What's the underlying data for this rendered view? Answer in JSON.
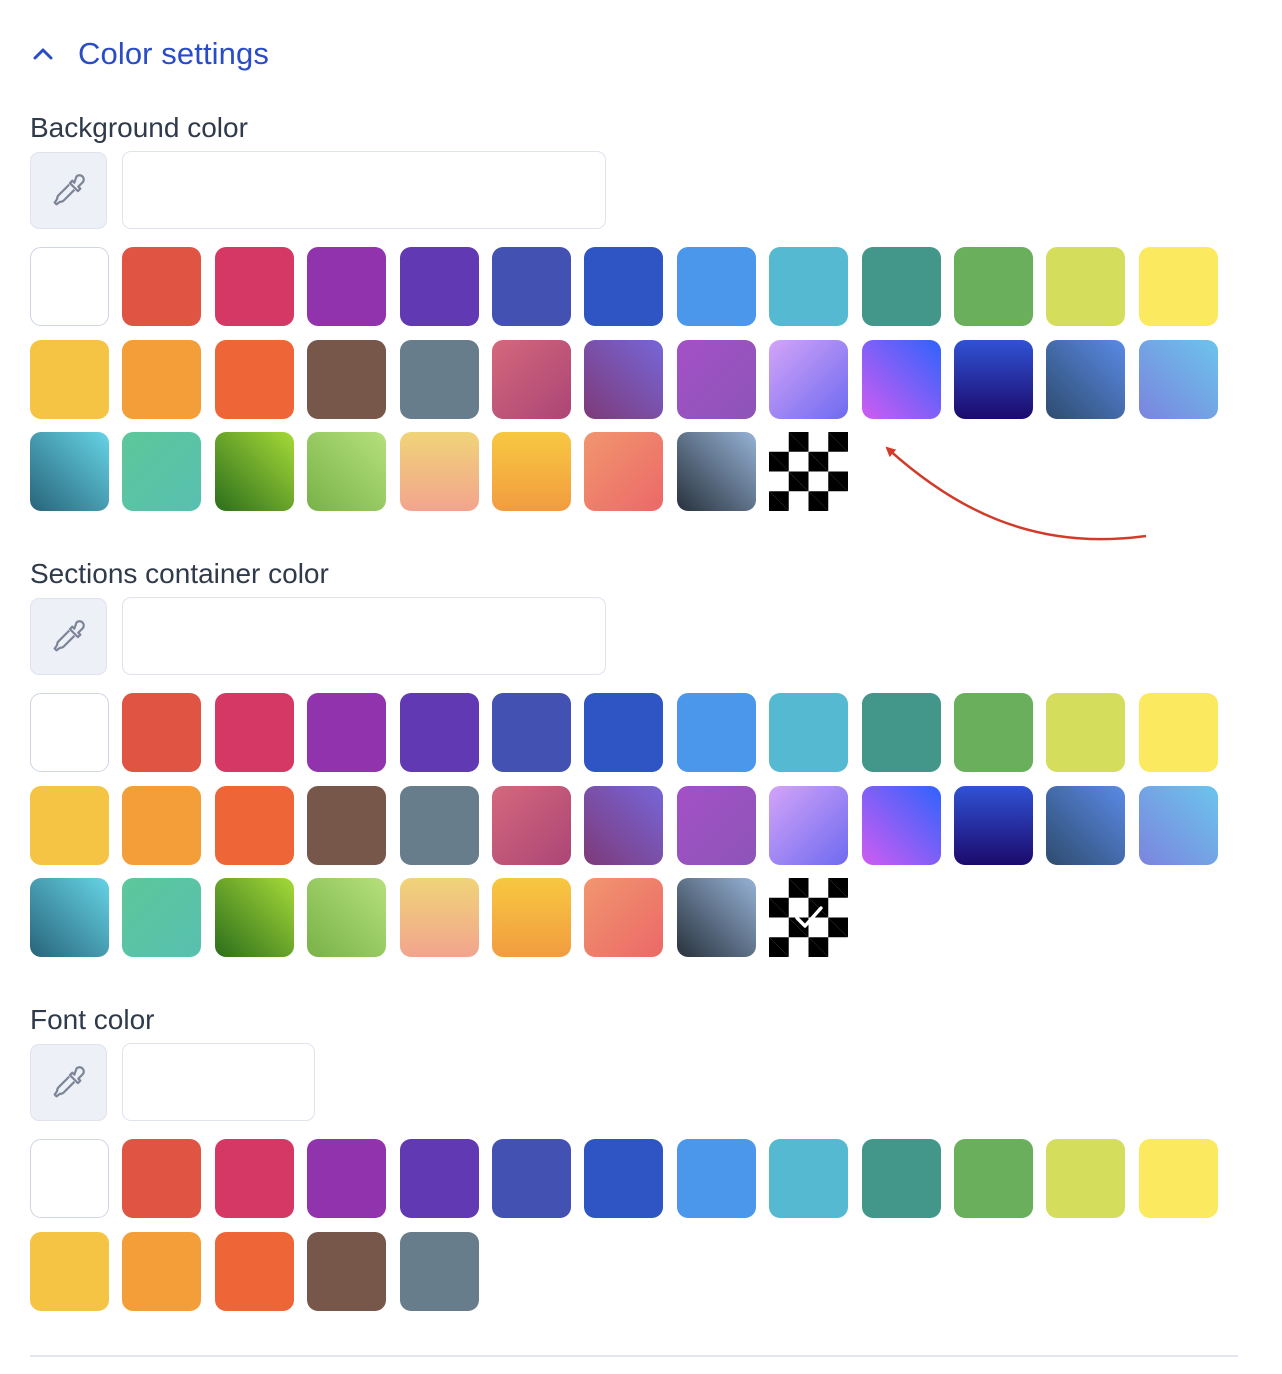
{
  "section": {
    "title": "Color settings",
    "chevron_icon": "chevron-up-icon",
    "accent_color": "#2a4cc7"
  },
  "palettes": {
    "solid": [
      "#ffffff",
      "#e05444",
      "#d63866",
      "#9133ac",
      "#6139b2",
      "#4352b2",
      "#2e55c3",
      "#4b97ec",
      "#56b9d2",
      "#43968a",
      "#6aaf5c",
      "#d4dd5c",
      "#fbea60",
      "#f6c444",
      "#f39e38",
      "#ee6637",
      "#765749",
      "#687d8b"
    ],
    "gradient": [
      "linear-gradient(135deg,#d4687c,#ab4576)",
      "linear-gradient(45deg,#7e3a78,#7666d8)",
      "linear-gradient(135deg,#a450c6,#8c55b8)",
      "linear-gradient(135deg,#d3a4f8,#6e6af0)",
      "linear-gradient(45deg,#d05cf2,#2f63fc)",
      "linear-gradient(180deg,#3052d4,#1c0a6c)",
      "linear-gradient(45deg,#2e4c6e,#5a8ae6)",
      "linear-gradient(45deg,#7b84de,#6cc4ec)",
      "linear-gradient(45deg,#28647a,#66d4e6)",
      "linear-gradient(135deg,#5cc89a,#58bfb0)",
      "linear-gradient(45deg,#2c6e1c,#a6da38)",
      "linear-gradient(45deg,#78b248,#b6e07c)",
      "linear-gradient(180deg,#f0d478,#f2a48e)",
      "linear-gradient(180deg,#f7c840,#f29c40)",
      "linear-gradient(135deg,#f1966e,#ec6868)",
      "linear-gradient(45deg,#28323c,#96b2d6)"
    ]
  },
  "background_color": {
    "label": "Background color",
    "eyedropper_icon": "eyedropper-icon",
    "hex_value": "",
    "selected": "none"
  },
  "sections_container_color": {
    "label": "Sections container color",
    "eyedropper_icon": "eyedropper-icon",
    "hex_value": "",
    "selected": "transparent"
  },
  "font_color": {
    "label": "Font color",
    "eyedropper_icon": "eyedropper-icon",
    "hex_value": "",
    "selected": "none"
  },
  "annotation": {
    "type": "red curved arrow",
    "color": "#d13b2a",
    "points_to": "background_color gradient swatch (purple-to-blue)"
  }
}
